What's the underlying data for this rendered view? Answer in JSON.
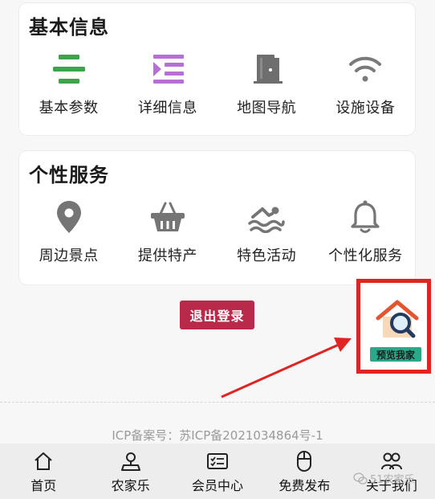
{
  "colors": {
    "accent_green": "#3fa34d",
    "accent_purple": "#b66fd6",
    "logout_bg": "#b8294a",
    "highlight_red": "#e02424"
  },
  "basic_info": {
    "title": "基本信息",
    "items": [
      {
        "label": "基本参数",
        "icon": "list-lines-icon"
      },
      {
        "label": "详细信息",
        "icon": "list-indent-icon"
      },
      {
        "label": "地图导航",
        "icon": "door-icon"
      },
      {
        "label": "设施设备",
        "icon": "wifi-icon"
      }
    ]
  },
  "personal_services": {
    "title": "个性服务",
    "items": [
      {
        "label": "周边景点",
        "icon": "location-pin-icon"
      },
      {
        "label": "提供特产",
        "icon": "basket-icon"
      },
      {
        "label": "特色活动",
        "icon": "swimming-icon"
      },
      {
        "label": "个性化服务",
        "icon": "bell-icon"
      }
    ]
  },
  "logout_label": "退出登录",
  "preview": {
    "label": "预览我家",
    "icon": "house-search-icon"
  },
  "icp_text": "ICP备案号：苏ICP备2021034864号-1",
  "tabbar": [
    {
      "label": "首页",
      "icon": "home-icon"
    },
    {
      "label": "农家乐",
      "icon": "user-pin-icon"
    },
    {
      "label": "会员中心",
      "icon": "member-card-icon"
    },
    {
      "label": "免费发布",
      "icon": "mouse-icon"
    },
    {
      "label": "关于我们",
      "icon": "people-icon"
    }
  ],
  "watermark_text": "51农家乐"
}
